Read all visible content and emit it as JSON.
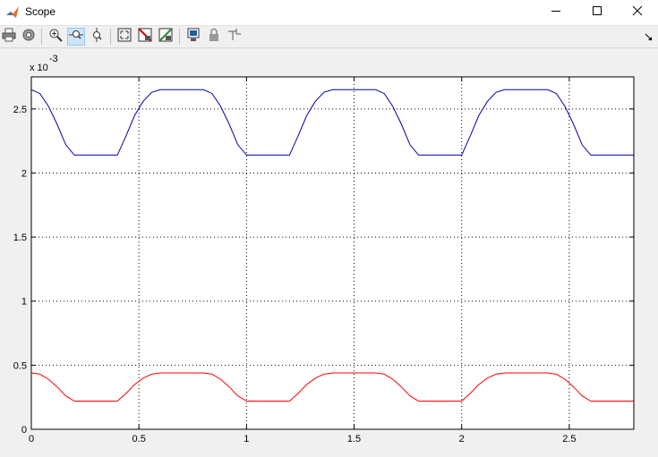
{
  "window": {
    "title": "Scope",
    "controls": {
      "minimize": "minimize-icon",
      "maximize": "maximize-icon",
      "close": "close-icon"
    }
  },
  "toolbar": {
    "items": [
      {
        "icon": "print-icon"
      },
      {
        "icon": "parameters-icon"
      },
      {
        "icon": "zoom-in-icon"
      },
      {
        "icon": "zoom-x-icon",
        "active": true
      },
      {
        "icon": "zoom-y-icon"
      },
      {
        "icon": "autoscale-icon"
      },
      {
        "icon": "save-axes-icon"
      },
      {
        "icon": "restore-axes-icon"
      },
      {
        "icon": "floating-scope-icon"
      },
      {
        "icon": "lock-axes-icon"
      },
      {
        "icon": "signal-selection-icon"
      }
    ]
  },
  "chart_data": {
    "type": "line",
    "exponent_label": "x 10",
    "exponent_power": "-3",
    "xlim": [
      0,
      2.8
    ],
    "ylim": [
      0,
      2.75
    ],
    "x_ticks": [
      "0",
      "0.5",
      "1",
      "1.5",
      "2",
      "2.5"
    ],
    "x_tick_values": [
      0,
      0.5,
      1,
      1.5,
      2,
      2.5
    ],
    "y_ticks": [
      "0",
      "0.5",
      "1",
      "1.5",
      "2",
      "2.5"
    ],
    "y_tick_values": [
      0,
      0.5,
      1,
      1.5,
      2,
      2.5
    ],
    "grid": true,
    "background": "#ffffff",
    "series": [
      {
        "color": "#0000aa",
        "x": [
          0,
          0.04,
          0.08,
          0.12,
          0.16,
          0.2,
          0.4,
          0.44,
          0.48,
          0.52,
          0.56,
          0.6,
          0.8,
          0.84,
          0.88,
          0.92,
          0.96,
          1.0,
          1.2,
          1.24,
          1.28,
          1.32,
          1.36,
          1.4,
          1.6,
          1.64,
          1.68,
          1.72,
          1.76,
          1.8,
          2.0,
          2.04,
          2.08,
          2.12,
          2.16,
          2.2,
          2.4,
          2.44,
          2.48,
          2.52,
          2.56,
          2.6,
          2.8
        ],
        "y": [
          2.65,
          2.62,
          2.52,
          2.38,
          2.22,
          2.14,
          2.14,
          2.29,
          2.45,
          2.56,
          2.63,
          2.65,
          2.65,
          2.62,
          2.52,
          2.38,
          2.22,
          2.14,
          2.14,
          2.29,
          2.45,
          2.56,
          2.63,
          2.65,
          2.65,
          2.62,
          2.52,
          2.38,
          2.22,
          2.14,
          2.14,
          2.29,
          2.45,
          2.56,
          2.63,
          2.65,
          2.65,
          2.62,
          2.52,
          2.38,
          2.22,
          2.14,
          2.14
        ]
      },
      {
        "color": "#ff0000",
        "x": [
          0,
          0.04,
          0.08,
          0.12,
          0.16,
          0.2,
          0.4,
          0.44,
          0.48,
          0.52,
          0.56,
          0.6,
          0.8,
          0.84,
          0.88,
          0.92,
          0.96,
          1.0,
          1.2,
          1.24,
          1.28,
          1.32,
          1.36,
          1.4,
          1.6,
          1.64,
          1.68,
          1.72,
          1.76,
          1.8,
          2.0,
          2.04,
          2.08,
          2.12,
          2.16,
          2.2,
          2.4,
          2.44,
          2.48,
          2.52,
          2.56,
          2.6,
          2.8
        ],
        "y": [
          0.44,
          0.43,
          0.39,
          0.33,
          0.26,
          0.22,
          0.22,
          0.28,
          0.35,
          0.4,
          0.43,
          0.44,
          0.44,
          0.43,
          0.39,
          0.33,
          0.26,
          0.22,
          0.22,
          0.28,
          0.35,
          0.4,
          0.43,
          0.44,
          0.44,
          0.43,
          0.39,
          0.33,
          0.26,
          0.22,
          0.22,
          0.28,
          0.35,
          0.4,
          0.43,
          0.44,
          0.44,
          0.43,
          0.39,
          0.33,
          0.26,
          0.22,
          0.22
        ]
      }
    ]
  }
}
